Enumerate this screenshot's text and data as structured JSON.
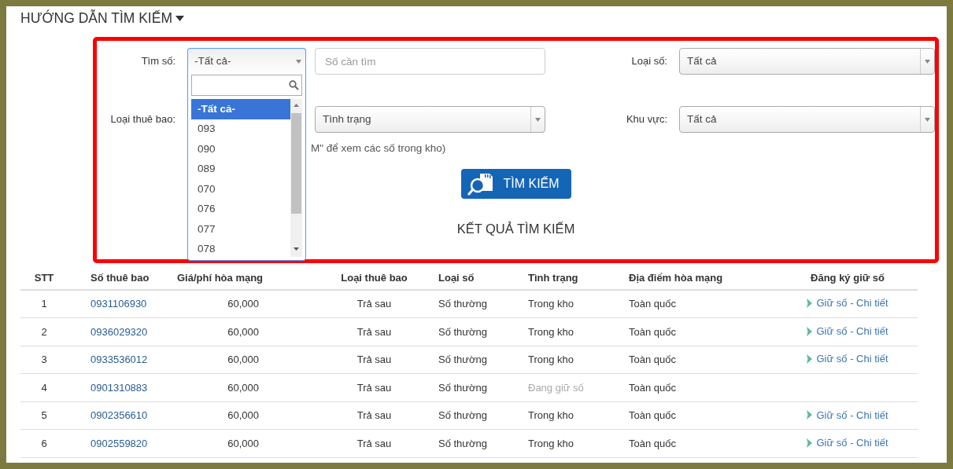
{
  "header": {
    "title": "HƯỚNG DẪN TÌM KIẾM"
  },
  "prefix_select": {
    "label": "Tìm số:",
    "value": "-Tất cả-",
    "expanded": true,
    "options": [
      {
        "text": "-Tất cả-",
        "selected": true
      },
      {
        "text": "093",
        "selected": false
      },
      {
        "text": "090",
        "selected": false
      },
      {
        "text": "089",
        "selected": false
      },
      {
        "text": "070",
        "selected": false
      },
      {
        "text": "076",
        "selected": false
      },
      {
        "text": "077",
        "selected": false
      },
      {
        "text": "078",
        "selected": false
      }
    ]
  },
  "number_field": {
    "placeholder": "Số cần tìm"
  },
  "number_type": {
    "label": "Loại số:",
    "value": "Tất cả"
  },
  "subscriber_type": {
    "label": "Loại thuê bao:"
  },
  "status_select": {
    "value": "Tình trạng"
  },
  "region": {
    "label": "Khu vực:",
    "value": "Tất cả"
  },
  "hint": "M\" để xem các số trong kho)",
  "search_button": "TÌM KIẾM",
  "results_title": "KẾT QUẢ TÌM KIẾM",
  "table": {
    "columns": [
      "STT",
      "Số thuê bao",
      "Giá/phí hòa mạng",
      "Loại thuê bao",
      "Loại số",
      "Tình trạng",
      "Địa điểm hòa mạng",
      "Đăng ký giữ số"
    ],
    "rows": [
      {
        "cells": [
          "1",
          "0931106930",
          "60,000",
          "Trả sau",
          "Số thường",
          "Trong kho",
          "Toàn quốc"
        ],
        "held": false,
        "action": "Giữ số - Chi tiết"
      },
      {
        "cells": [
          "2",
          "0936029320",
          "60,000",
          "Trả sau",
          "Số thường",
          "Trong kho",
          "Toàn quốc"
        ],
        "held": false,
        "action": "Giữ số - Chi tiết"
      },
      {
        "cells": [
          "3",
          "0933536012",
          "60,000",
          "Trả sau",
          "Số thường",
          "Trong kho",
          "Toàn quốc"
        ],
        "held": false,
        "action": "Giữ số - Chi tiết"
      },
      {
        "cells": [
          "4",
          "0901310883",
          "60,000",
          "Trả sau",
          "Số thường",
          "Đang giữ số",
          "Toàn quốc"
        ],
        "held": true
      },
      {
        "cells": [
          "5",
          "0902356610",
          "60,000",
          "Trả sau",
          "Số thường",
          "Trong kho",
          "Toàn quốc"
        ],
        "held": false,
        "action": "Giữ số - Chi tiết"
      },
      {
        "cells": [
          "6",
          "0902559820",
          "60,000",
          "Trả sau",
          "Số thường",
          "Trong kho",
          "Toàn quốc"
        ],
        "held": false,
        "action": "Giữ số - Chi tiết"
      }
    ]
  }
}
